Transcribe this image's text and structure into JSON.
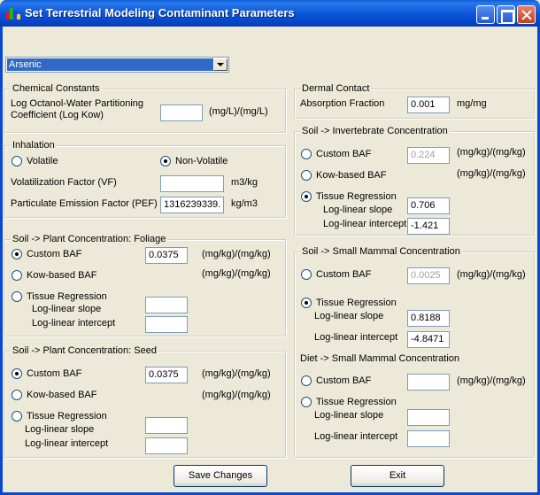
{
  "window": {
    "title": "Set Terrestrial Modeling Contaminant Parameters"
  },
  "contaminant_select": {
    "value": "Arsenic"
  },
  "chemical_constants": {
    "legend": "Chemical Constants",
    "label_line1": "Log Octanol-Water Partitioning",
    "label_line2": "Coefficient (Log Kow)",
    "value": "",
    "unit": "(mg/L)/(mg/L)"
  },
  "inhalation": {
    "legend": "Inhalation",
    "volatile_label": "Volatile",
    "nonvolatile_label": "Non-Volatile",
    "selected": "Non-Volatile",
    "vf_label": "Volatilization Factor (VF)",
    "vf_value": "",
    "vf_unit": "m3/kg",
    "pef_label": "Particulate Emission Factor (PEF)",
    "pef_value": "1316239339.",
    "pef_unit": "kg/m3"
  },
  "plant_foliage": {
    "legend": "Soil -> Plant Concentration: Foliage",
    "custom_label": "Custom BAF",
    "custom_value": "0.0375",
    "custom_unit": "(mg/kg)/(mg/kg)",
    "kow_label": "Kow-based BAF",
    "kow_unit": "(mg/kg)/(mg/kg)",
    "tissue_label": "Tissue Regression",
    "slope_label": "Log-linear slope",
    "slope_value": "",
    "intercept_label": "Log-linear intercept",
    "intercept_value": "",
    "selected": "Custom BAF"
  },
  "plant_seed": {
    "legend": "Soil -> Plant Concentration: Seed",
    "custom_label": "Custom BAF",
    "custom_value": "0.0375",
    "custom_unit": "(mg/kg)/(mg/kg)",
    "kow_label": "Kow-based BAF",
    "kow_unit": "(mg/kg)/(mg/kg)",
    "tissue_label": "Tissue Regression",
    "slope_label": "Log-linear slope",
    "slope_value": "",
    "intercept_label": "Log-linear intercept",
    "intercept_value": "",
    "selected": "Custom BAF"
  },
  "dermal": {
    "legend": "Dermal Contact",
    "label": "Absorption Fraction",
    "value": "0.001",
    "unit": "mg/mg"
  },
  "invertebrate": {
    "legend": "Soil -> Invertebrate Concentration",
    "custom_label": "Custom BAF",
    "custom_value": "0.224",
    "custom_unit": "(mg/kg)/(mg/kg)",
    "kow_label": "Kow-based BAF",
    "kow_unit": "(mg/kg)/(mg/kg)",
    "tissue_label": "Tissue Regression",
    "slope_label": "Log-linear slope",
    "slope_value": "0.706",
    "intercept_label": "Log-linear intercept",
    "intercept_value": "-1.421",
    "selected": "Tissue Regression"
  },
  "small_mammal": {
    "legend": "Soil -> Small Mammal Concentration",
    "custom_label": "Custom BAF",
    "custom_value": "0.0025",
    "custom_unit": "(mg/kg)/(mg/kg)",
    "tissue_label": "Tissue Regression",
    "slope_label": "Log-linear slope",
    "slope_value": "0.8188",
    "intercept_label": "Log-linear intercept",
    "intercept_value": "-4.8471",
    "selected": "Tissue Regression",
    "diet_title": "Diet -> Small Mammal Concentration",
    "diet_custom_label": "Custom BAF",
    "diet_custom_value": "",
    "diet_custom_unit": "(mg/kg)/(mg/kg)",
    "diet_tissue_label": "Tissue Regression",
    "diet_slope_label": "Log-linear slope",
    "diet_slope_value": "",
    "diet_intercept_label": "Log-linear intercept",
    "diet_intercept_value": ""
  },
  "buttons": {
    "save": "Save Changes",
    "exit": "Exit"
  }
}
